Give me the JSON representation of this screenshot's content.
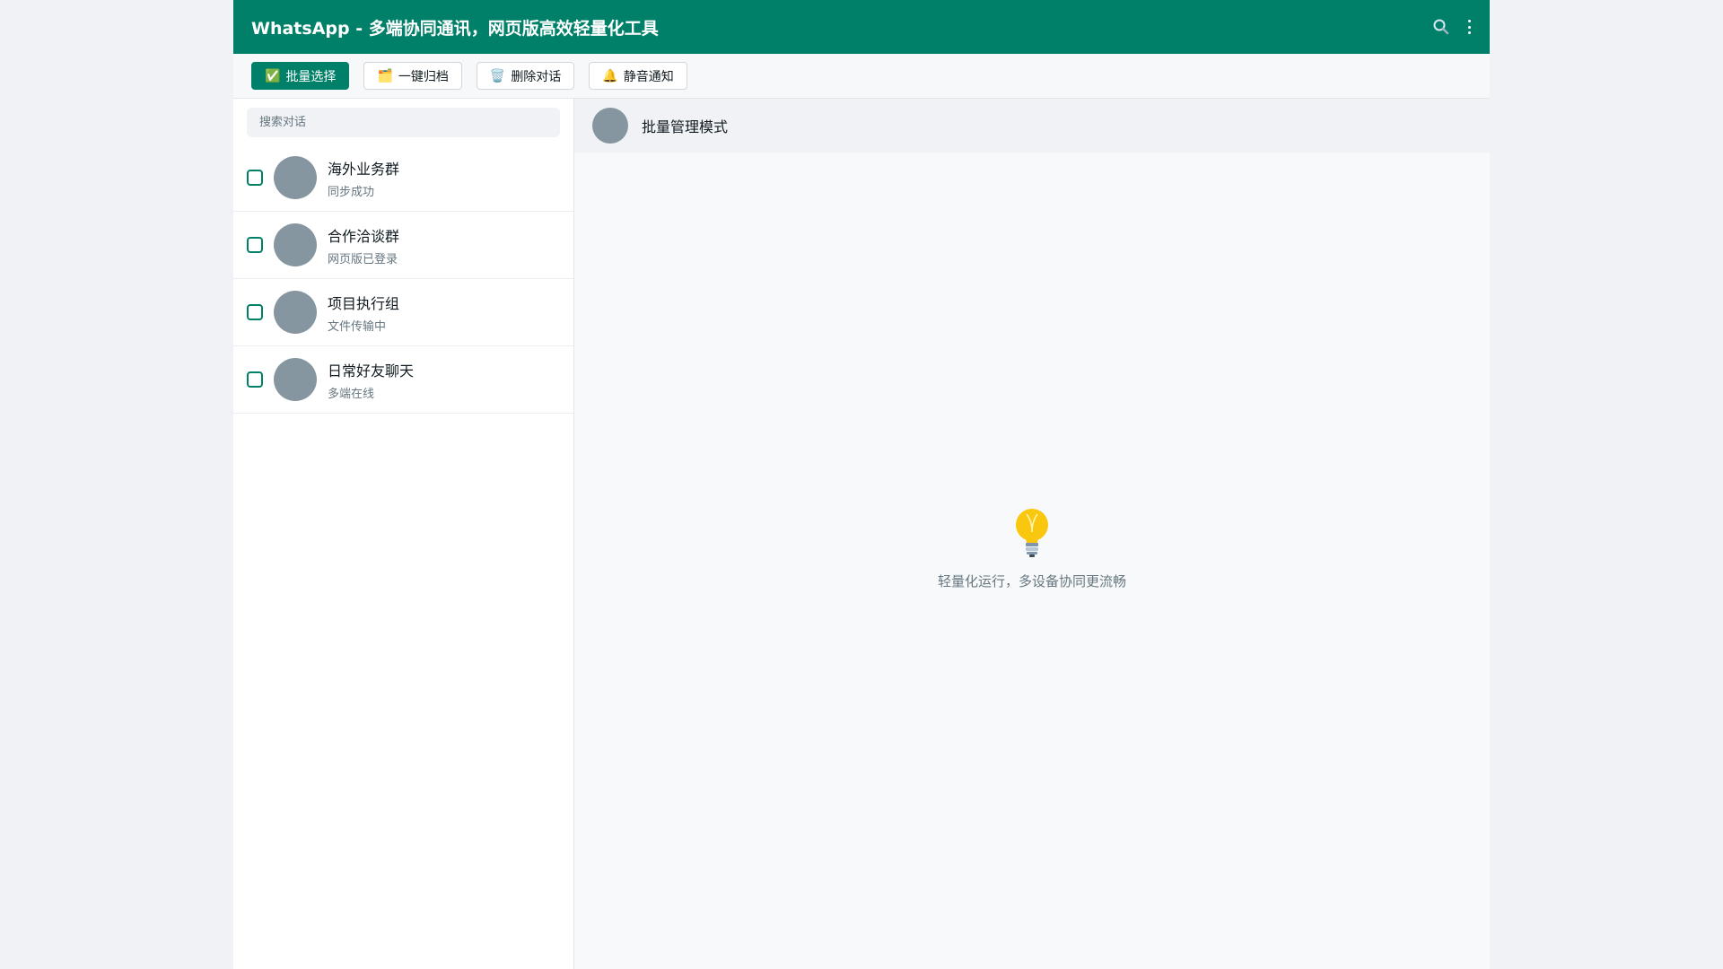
{
  "header": {
    "title": "WhatsApp - 多端协同通讯，网页版高效轻量化工具",
    "search_icon": "search-icon",
    "menu_icon": "kebab-menu-icon"
  },
  "toolbar": {
    "buttons": [
      {
        "emoji": "✅",
        "label": "批量选择",
        "primary": true
      },
      {
        "emoji": "🗂️",
        "label": "一键归档"
      },
      {
        "emoji": "🗑️",
        "label": "删除对话"
      },
      {
        "emoji": "🔔",
        "label": "静音通知"
      }
    ]
  },
  "sidebar": {
    "search_placeholder": "搜索对话",
    "chats": [
      {
        "name": "海外业务群",
        "status": "同步成功"
      },
      {
        "name": "合作洽谈群",
        "status": "网页版已登录"
      },
      {
        "name": "项目执行组",
        "status": "文件传输中"
      },
      {
        "name": "日常好友聊天",
        "status": "多端在线"
      }
    ]
  },
  "content": {
    "header_title": "批量管理模式",
    "placeholder_icon": "lightbulb-icon",
    "placeholder_text": "轻量化运行，多设备协同更流畅"
  },
  "colors": {
    "brand": "#008069",
    "avatar": "#8696a0",
    "page_bg": "#f0f2f5"
  }
}
